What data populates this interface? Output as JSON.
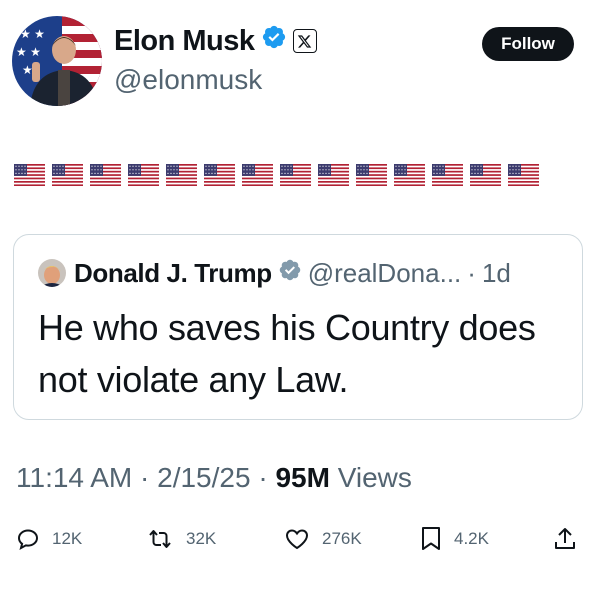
{
  "author": {
    "name": "Elon Musk",
    "handle": "@elonmusk",
    "verified": true,
    "affiliate_badge": "x-logo-icon"
  },
  "follow_label": "Follow",
  "tweet": {
    "flag_count": 14,
    "flag_icon": "us-flag-emoji"
  },
  "quote": {
    "name": "Donald J. Trump",
    "handle": "@realDona...",
    "time": "1d",
    "text": "He who saves his Country does not violate any Law."
  },
  "meta": {
    "time": "11:14 AM",
    "date": "2/15/25",
    "views_count": "95M",
    "views_label": "Views"
  },
  "actions": {
    "replies": "12K",
    "reposts": "32K",
    "likes": "276K",
    "bookmarks": "4.2K"
  },
  "colors": {
    "text": "#0f1419",
    "secondary": "#536471",
    "verified": "#1d9bf0",
    "border": "#cfd9de"
  }
}
